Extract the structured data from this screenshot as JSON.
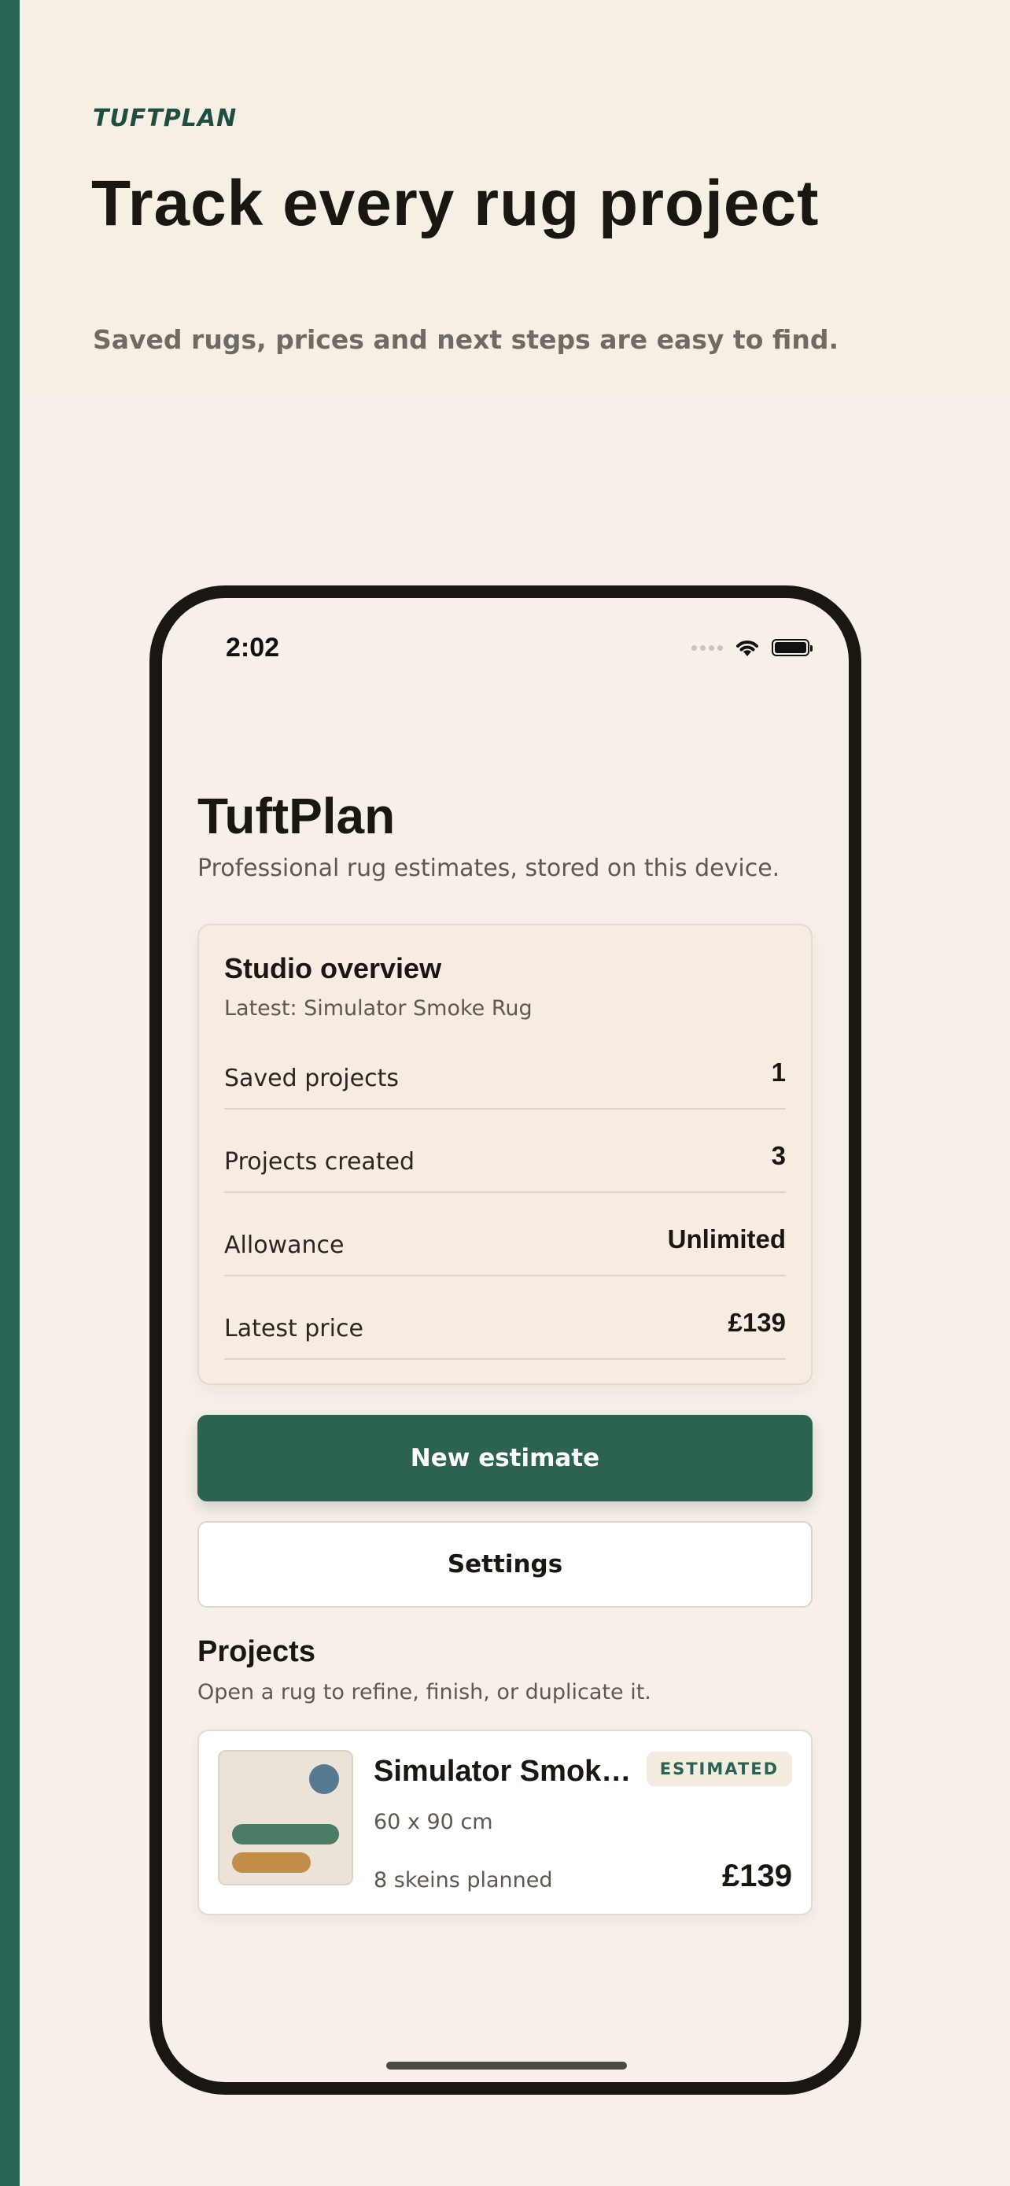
{
  "hero": {
    "brand": "TUFTPLAN",
    "title": "Track every rug project",
    "subtitle": "Saved rugs, prices and next steps are easy to find."
  },
  "status_bar": {
    "time": "2:02",
    "icons": [
      "signal-icon",
      "wifi-icon",
      "battery-icon"
    ]
  },
  "app": {
    "title": "TuftPlan",
    "subtitle": "Professional rug estimates, stored on this device."
  },
  "overview": {
    "title": "Studio overview",
    "latest": "Latest: Simulator Smoke Rug",
    "stats": [
      {
        "label": "Saved projects",
        "value": "1"
      },
      {
        "label": "Projects created",
        "value": "3"
      },
      {
        "label": "Allowance",
        "value": "Unlimited"
      },
      {
        "label": "Latest price",
        "value": "£139"
      }
    ]
  },
  "actions": {
    "new_estimate": "New estimate",
    "settings": "Settings"
  },
  "projects": {
    "title": "Projects",
    "subtitle": "Open a rug to refine, finish, or duplicate it.",
    "items": [
      {
        "name": "Simulator Smoke Rug",
        "status": "ESTIMATED",
        "size": "60 x 90 cm",
        "skeins": "8 skeins planned",
        "price": "£139"
      }
    ]
  },
  "colors": {
    "accent": "#2b6251",
    "background": "#f6f0e8",
    "card": "#f6ece2"
  }
}
